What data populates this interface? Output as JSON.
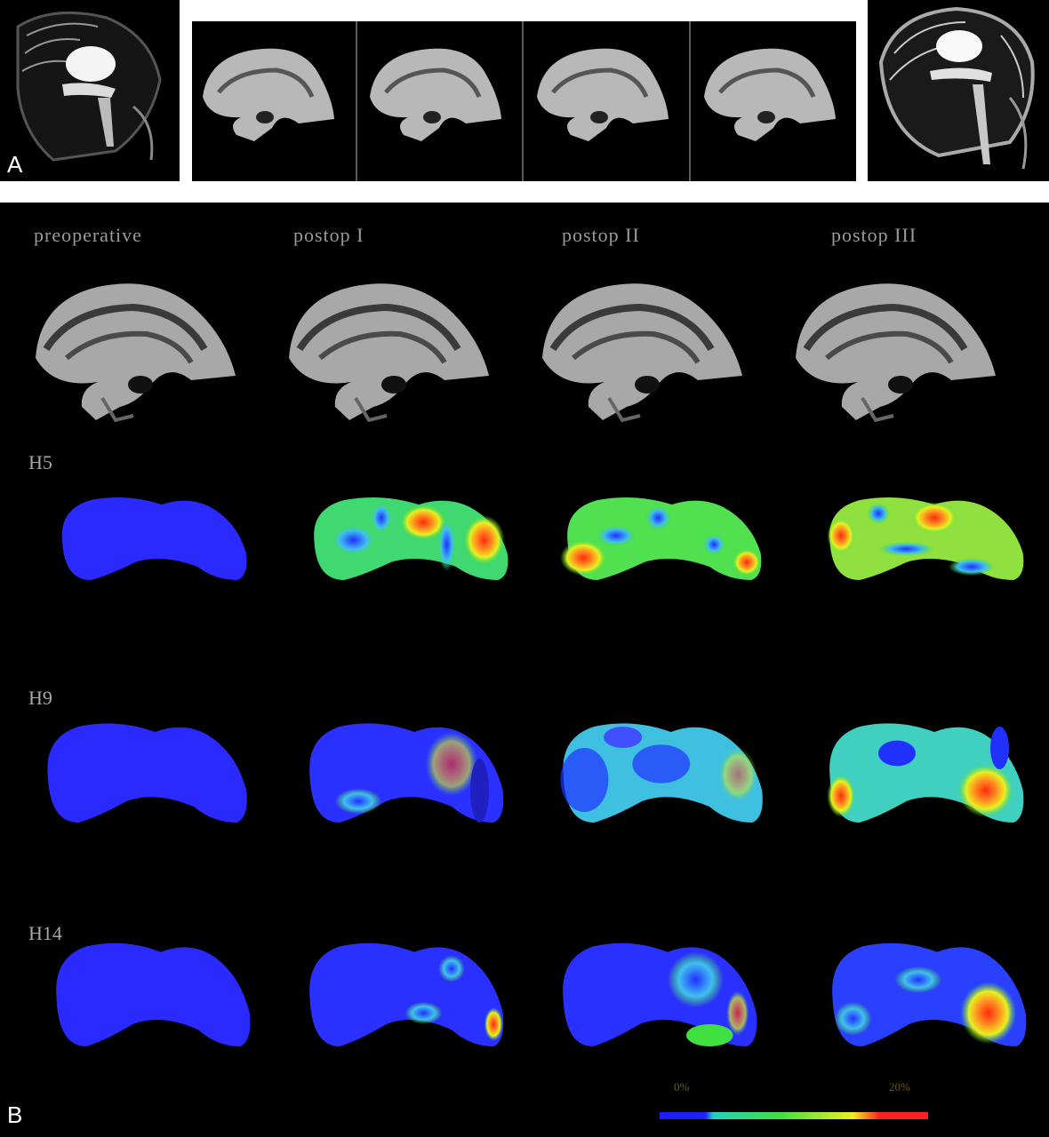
{
  "panel_a": {
    "label": "A"
  },
  "panel_b": {
    "label": "B",
    "columns": [
      "preoperative",
      "postop I",
      "postop II",
      "postop III"
    ],
    "rows": [
      "H5",
      "H9",
      "H14"
    ],
    "scale": {
      "min_label": "0%",
      "max_label": "20%",
      "colors": [
        "#2020ff",
        "#22d3c0",
        "#40e040",
        "#f0f020",
        "#ff2020"
      ]
    }
  }
}
